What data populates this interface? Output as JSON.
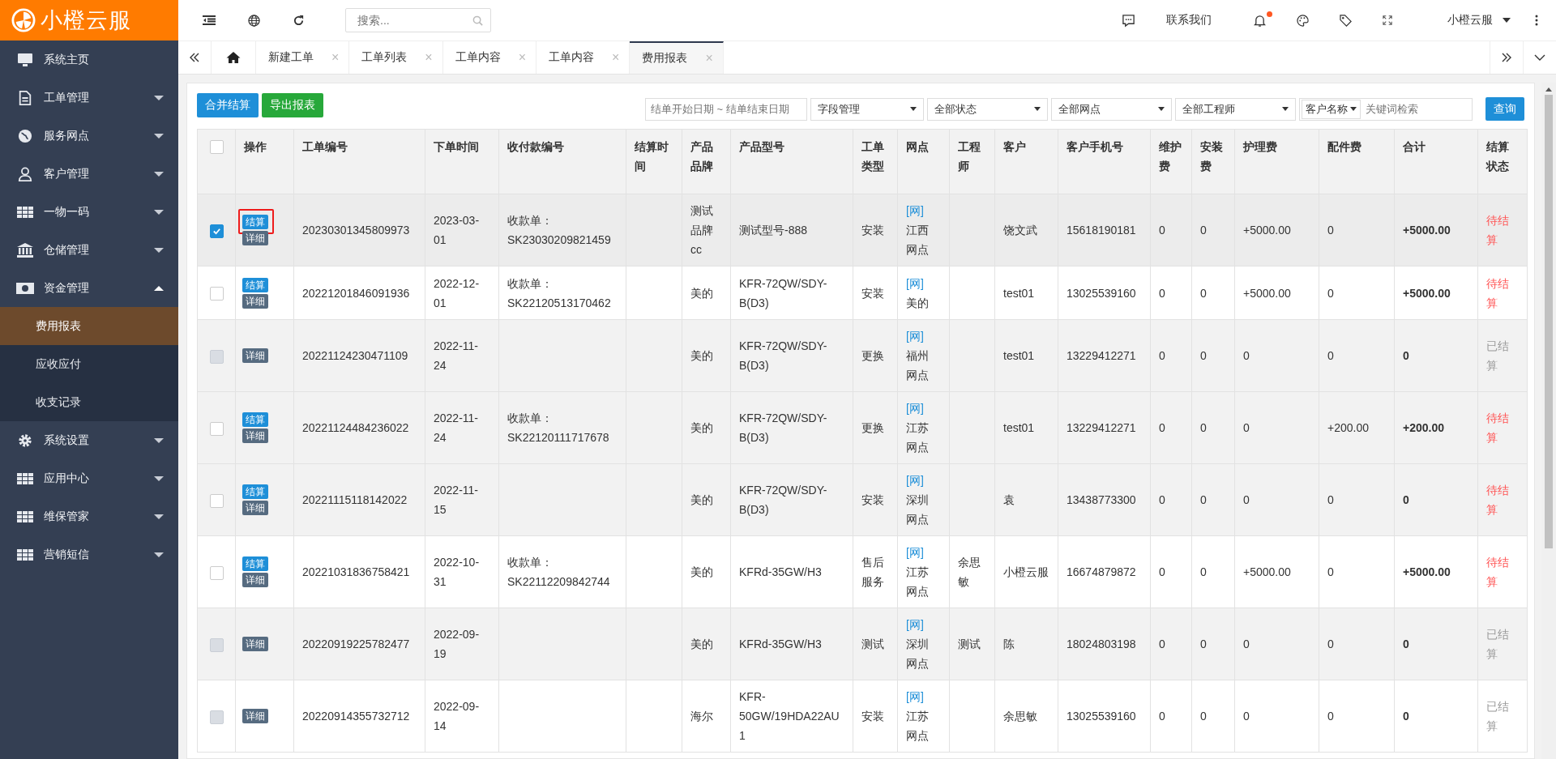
{
  "logo": {
    "text": "小橙云服"
  },
  "sidebar": {
    "items": [
      {
        "label": "系统主页"
      },
      {
        "label": "工单管理",
        "expanded": false
      },
      {
        "label": "服务网点",
        "expanded": false
      },
      {
        "label": "客户管理",
        "expanded": false
      },
      {
        "label": "一物一码",
        "expanded": false
      },
      {
        "label": "仓储管理",
        "expanded": false
      },
      {
        "label": "资金管理",
        "expanded": true,
        "children": [
          {
            "label": "费用报表",
            "selected": true
          },
          {
            "label": "应收应付",
            "selected": false
          },
          {
            "label": "收支记录",
            "selected": false
          }
        ]
      },
      {
        "label": "系统设置",
        "expanded": false
      },
      {
        "label": "应用中心",
        "expanded": false
      },
      {
        "label": "维保管家",
        "expanded": false
      },
      {
        "label": "营销短信",
        "expanded": false
      }
    ]
  },
  "header": {
    "search": {
      "placeholder": "搜索..."
    },
    "contact": "联系我们",
    "notification_dot": true,
    "user": "小橙云服"
  },
  "tabs": [
    {
      "label": "新建工单",
      "selected": false,
      "close": "×"
    },
    {
      "label": "工单列表",
      "selected": false,
      "close": "×"
    },
    {
      "label": "工单内容",
      "selected": false,
      "close": "×"
    },
    {
      "label": "工单内容",
      "selected": false,
      "close": "×"
    },
    {
      "label": "费用报表",
      "selected": true,
      "close": "×"
    }
  ],
  "toolbar": {
    "buttons": [
      {
        "label": "合并结算",
        "kind": "primary"
      },
      {
        "label": "导出报表",
        "kind": "success"
      }
    ],
    "date_range": {
      "placeholder": "结单开始日期 ~ 结单结束日期"
    },
    "selects": [
      "字段管理",
      "全部状态",
      "全部网点",
      "全部工程师"
    ],
    "customer_field": {
      "label": "客户名称",
      "placeholder": "关键词检索"
    },
    "query_button": "查询"
  },
  "table": {
    "select_all_checked": false,
    "columns": [
      "操作",
      "工单编号",
      "下单时间",
      "收付款编号",
      "结算时间",
      "产品品牌",
      "产品型号",
      "工单类型",
      "网点",
      "工程师",
      "客户",
      "客户手机号",
      "维护费",
      "安装费",
      "护理费",
      "配件费",
      "合计",
      "结算状态"
    ],
    "rows": [
      {
        "selected": true,
        "disabled": false,
        "actions": [
          {
            "label": "结算",
            "kind": "settle",
            "highlighted": true
          },
          {
            "label": "详细",
            "kind": "detail",
            "highlighted": false
          }
        ],
        "order_no": "20230301345809973",
        "order_time": "2023-03-01",
        "receipt_no": "收款单：SK23030209821459",
        "brand": "测试品牌cc",
        "model": "测试型号-888",
        "type": "安装",
        "network_tag": "[网]",
        "network": "江西网点",
        "customer": "饶文武",
        "phone": "15618190181",
        "maintenance_fee": "0",
        "install_fee": "0",
        "care_fee": "+5000.00",
        "parts_fee": "0",
        "total": "+5000.00",
        "status": "待结算",
        "settled": false
      },
      {
        "selected": false,
        "disabled": false,
        "actions": [
          {
            "label": "结算",
            "kind": "settle",
            "highlighted": false
          },
          {
            "label": "详细",
            "kind": "detail",
            "highlighted": false
          }
        ],
        "order_no": "20221201846091936",
        "order_time": "2022-12-01",
        "receipt_no": "收款单：SK22120513170462",
        "brand": "美的",
        "model": "KFR-72QW/SDY-B(D3)",
        "type": "安装",
        "network_tag": "[网]",
        "network": "美的",
        "customer": "test01",
        "phone": "13025539160",
        "maintenance_fee": "0",
        "install_fee": "0",
        "care_fee": "+5000.00",
        "parts_fee": "0",
        "total": "+5000.00",
        "status": "待结算",
        "settled": false
      },
      {
        "selected": false,
        "disabled": true,
        "actions": [
          {
            "label": "详细",
            "kind": "detail",
            "highlighted": false
          }
        ],
        "order_no": "20221124230471109",
        "order_time": "2022-11-24",
        "brand": "美的",
        "model": "KFR-72QW/SDY-B(D3)",
        "type": "更换",
        "network_tag": "[网]",
        "network": "福州网点",
        "customer": "test01",
        "phone": "13229412271",
        "maintenance_fee": "0",
        "install_fee": "0",
        "care_fee": "0",
        "parts_fee": "0",
        "total": "0",
        "status": "已结算",
        "settled": true
      },
      {
        "selected": false,
        "disabled": false,
        "actions": [
          {
            "label": "结算",
            "kind": "settle",
            "highlighted": false
          },
          {
            "label": "详细",
            "kind": "detail",
            "highlighted": false
          }
        ],
        "order_no": "20221124484236022",
        "order_time": "2022-11-24",
        "receipt_no": "收款单：SK22120111717678",
        "brand": "美的",
        "model": "KFR-72QW/SDY-B(D3)",
        "type": "更换",
        "network_tag": "[网]",
        "network": "江苏网点",
        "customer": "test01",
        "phone": "13229412271",
        "maintenance_fee": "0",
        "install_fee": "0",
        "care_fee": "0",
        "parts_fee": "+200.00",
        "total": "+200.00",
        "status": "待结算",
        "settled": false
      },
      {
        "selected": false,
        "disabled": false,
        "actions": [
          {
            "label": "结算",
            "kind": "settle",
            "highlighted": false
          },
          {
            "label": "详细",
            "kind": "detail",
            "highlighted": false
          }
        ],
        "order_no": "20221115118142022",
        "order_time": "2022-11-15",
        "brand": "美的",
        "model": "KFR-72QW/SDY-B(D3)",
        "type": "安装",
        "network_tag": "[网]",
        "network": "深圳网点",
        "customer": "袁",
        "phone": "13438773300",
        "maintenance_fee": "0",
        "install_fee": "0",
        "care_fee": "0",
        "parts_fee": "0",
        "total": "0",
        "status": "待结算",
        "settled": false
      },
      {
        "selected": false,
        "disabled": false,
        "actions": [
          {
            "label": "结算",
            "kind": "settle",
            "highlighted": false
          },
          {
            "label": "详细",
            "kind": "detail",
            "highlighted": false
          }
        ],
        "order_no": "20221031836758421",
        "order_time": "2022-10-31",
        "receipt_no": "收款单：SK22112209842744",
        "brand": "美的",
        "model": "KFRd-35GW/H3",
        "type": "售后服务",
        "network_tag": "[网]",
        "network": "江苏网点",
        "engineer": "余思敏",
        "customer": "小橙云服",
        "phone": "16674879872",
        "maintenance_fee": "0",
        "install_fee": "0",
        "care_fee": "+5000.00",
        "parts_fee": "0",
        "total": "+5000.00",
        "status": "待结算",
        "settled": false
      },
      {
        "selected": false,
        "disabled": true,
        "actions": [
          {
            "label": "详细",
            "kind": "detail",
            "highlighted": false
          }
        ],
        "order_no": "20220919225782477",
        "order_time": "2022-09-19",
        "brand": "美的",
        "model": "KFRd-35GW/H3",
        "type": "测试",
        "network_tag": "[网]",
        "network": "深圳网点",
        "engineer": "测试",
        "customer": "陈",
        "phone": "18024803198",
        "maintenance_fee": "0",
        "install_fee": "0",
        "care_fee": "0",
        "parts_fee": "0",
        "total": "0",
        "status": "已结算",
        "settled": true
      },
      {
        "selected": false,
        "disabled": true,
        "actions": [
          {
            "label": "详细",
            "kind": "detail",
            "highlighted": false
          }
        ],
        "order_no": "20220914355732712",
        "order_time": "2022-09-14",
        "brand": "海尔",
        "model": "KFR-50GW/19HDA22AU1",
        "type": "安装",
        "network_tag": "[网]",
        "network": "江苏网点",
        "customer": "余思敏",
        "phone": "13025539160",
        "maintenance_fee": "0",
        "install_fee": "0",
        "care_fee": "0",
        "parts_fee": "0",
        "total": "0",
        "status": "已结算",
        "settled": true
      }
    ]
  }
}
